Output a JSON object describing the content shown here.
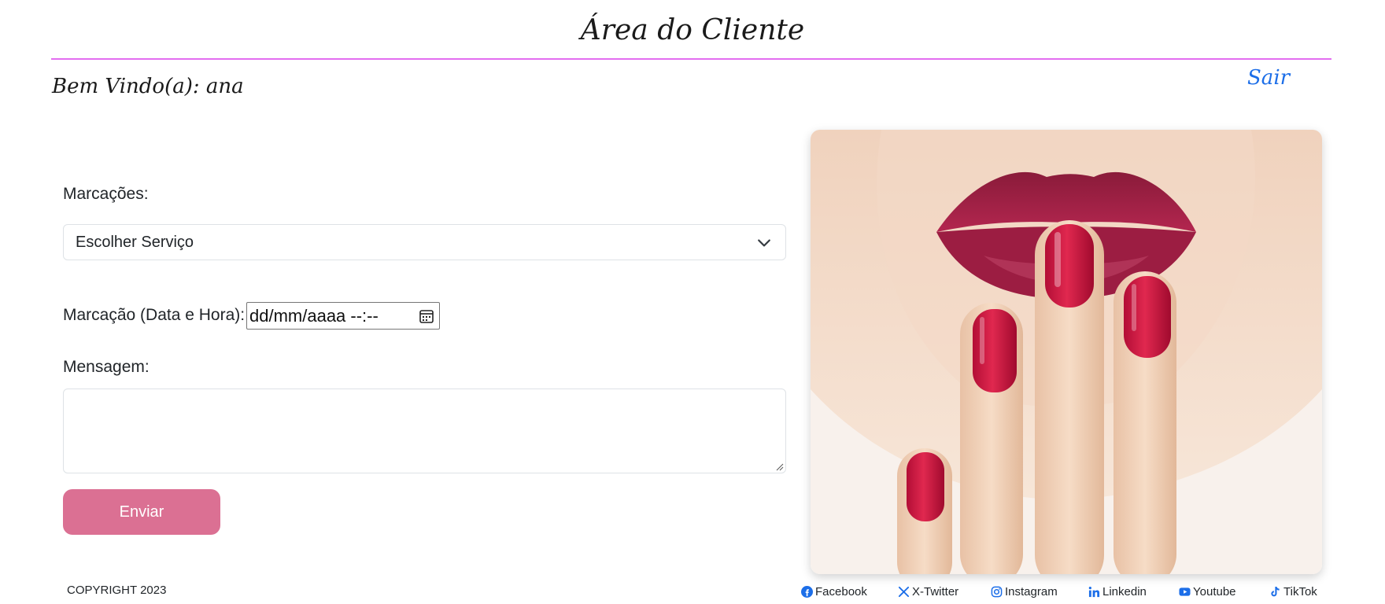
{
  "header": {
    "title": "Área do Cliente",
    "rule_color": "#e36ef0"
  },
  "user": {
    "welcome": "Bem Vindo(a): ana",
    "logout": "Sair"
  },
  "form": {
    "service_label": "Marcações:",
    "service_value": "Escolher Serviço",
    "datetime_label": "Marcação (Data e Hora):",
    "datetime_placeholder": "dd/mm/aaaa --:--",
    "message_label": "Mensagem:",
    "message_value": "",
    "submit": "Enviar",
    "submit_color": "#db7093"
  },
  "image": {
    "subject": "lips-and-red-nails-photo"
  },
  "footer": {
    "copyright": "COPYRIGHT 2023",
    "social": [
      {
        "label": "Facebook",
        "icon": "facebook-icon"
      },
      {
        "label": "X-Twitter",
        "icon": "x-twitter-icon"
      },
      {
        "label": "Instagram",
        "icon": "instagram-icon"
      },
      {
        "label": "Linkedin",
        "icon": "linkedin-icon"
      },
      {
        "label": "Youtube",
        "icon": "youtube-icon"
      },
      {
        "label": "TikTok",
        "icon": "tiktok-icon"
      }
    ],
    "link_icon_color": "#1c6ee8"
  }
}
